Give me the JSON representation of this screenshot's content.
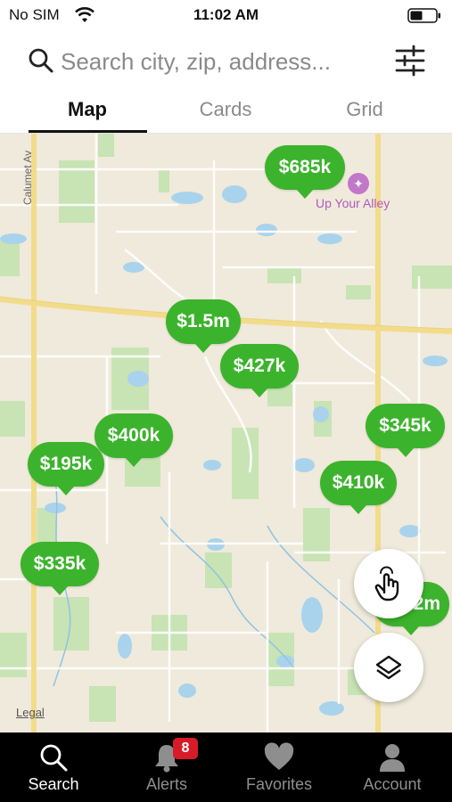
{
  "status_bar": {
    "carrier": "No SIM",
    "time": "11:02 AM"
  },
  "search": {
    "placeholder": "Search city, zip, address..."
  },
  "tabs": [
    {
      "label": "Map",
      "active": true
    },
    {
      "label": "Cards",
      "active": false
    },
    {
      "label": "Grid",
      "active": false
    }
  ],
  "map": {
    "street_label": "Calumet Av",
    "poi_label": "Up Your Alley",
    "legal": "Legal",
    "pins": [
      {
        "price": "$685k"
      },
      {
        "price": "$1.5m"
      },
      {
        "price": "$427k"
      },
      {
        "price": "$400k"
      },
      {
        "price": "$195k"
      },
      {
        "price": "$345k"
      },
      {
        "price": "$410k"
      },
      {
        "price": "$335k"
      },
      {
        "price": "$2m"
      }
    ]
  },
  "tab_bar": {
    "items": [
      {
        "label": "Search",
        "icon": "search-icon",
        "active": true
      },
      {
        "label": "Alerts",
        "icon": "bell-icon",
        "active": false,
        "badge": "8"
      },
      {
        "label": "Favorites",
        "icon": "heart-icon",
        "active": false
      },
      {
        "label": "Account",
        "icon": "person-icon",
        "active": false
      }
    ]
  },
  "colors": {
    "pin": "#3cb32c",
    "badge": "#d81b28",
    "tabbar": "#000000",
    "map_land": "#efeadb",
    "park": "#c8e3b4"
  }
}
